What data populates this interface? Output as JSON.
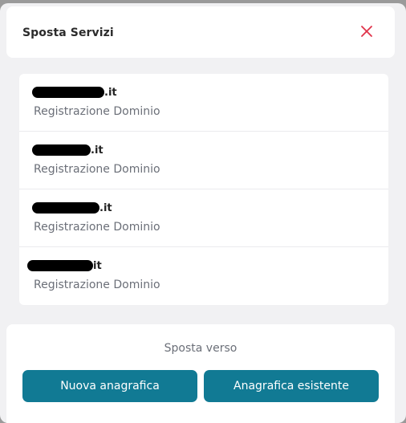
{
  "modal": {
    "title": "Sposta Servizi",
    "close_icon": "close-icon",
    "accent_color": "#e0334a"
  },
  "services": [
    {
      "domain_suffix": ".it",
      "service_type": "Registrazione Dominio"
    },
    {
      "domain_suffix": ".it",
      "service_type": "Registrazione Dominio"
    },
    {
      "domain_suffix": ".it",
      "service_type": "Registrazione Dominio"
    },
    {
      "domain_suffix": "it",
      "service_type": "Registrazione Dominio"
    }
  ],
  "footer": {
    "label": "Sposta verso",
    "new_button": "Nuova anagrafica",
    "existing_button": "Anagrafica esistente",
    "button_color": "#117a94"
  }
}
